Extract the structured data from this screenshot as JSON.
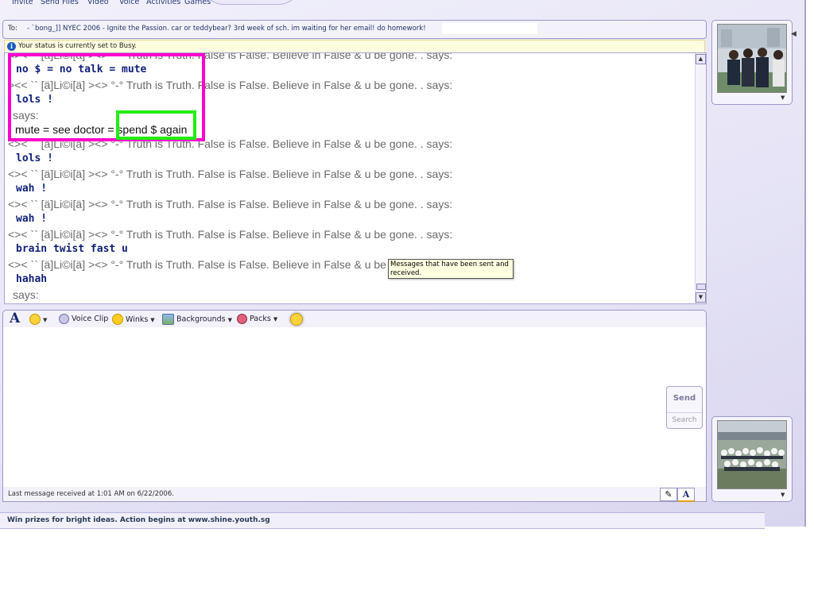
{
  "menu": {
    "items": [
      "Invite",
      "Send Files",
      "Video",
      "Voice",
      "Activities",
      "Games"
    ]
  },
  "to_bar": {
    "label": "To:",
    "recipient": "- `bong_]] NYEC 2006 - Ignite the Passion. car or teddybear?   3rd week of sch. im waiting for her email!   do homework!"
  },
  "status_notice": "Your status is currently set to Busy.",
  "conversation": [
    {
      "kind": "says",
      "text": "<>< `` [ä]Li©i[ä]  ><> °-° Truth is Truth. False is False. Believe in False & u be gone. . says:"
    },
    {
      "kind": "msg",
      "text": "no $ = no talk = mute"
    },
    {
      "kind": "says",
      "text": "><< `` [ä]Li©i[ä]  ><> °-° Truth is Truth. False is False. Believe in False & u be gone. . says:"
    },
    {
      "kind": "msg",
      "text": "lols !"
    },
    {
      "kind": "says",
      "text": "says:"
    },
    {
      "kind": "plain",
      "text": "mute  = see doctor = spend $ again"
    },
    {
      "kind": "says",
      "text": "<>< `` [ä]Li©i[ä]  ><> °-° Truth is Truth. False is False. Believe in False & u be gone. . says:"
    },
    {
      "kind": "msg",
      "text": "lols !"
    },
    {
      "kind": "says",
      "text": "<>< `` [ä]Li©i[ä]  ><> °-° Truth is Truth. False is False. Believe in False & u be gone. . says:"
    },
    {
      "kind": "msg",
      "text": "wah !"
    },
    {
      "kind": "says",
      "text": "<>< `` [ä]Li©i[ä]  ><> °-° Truth is Truth. False is False. Believe in False & u be gone. . says:"
    },
    {
      "kind": "msg",
      "text": "wah !"
    },
    {
      "kind": "says",
      "text": "<>< `` [ä]Li©i[ä]  ><> °-° Truth is Truth. False is False. Believe in False & u be gone. . says:"
    },
    {
      "kind": "msg",
      "text": "brain twist fast u"
    },
    {
      "kind": "says",
      "text": "<>< `` [ä]Li©i[ä]  ><> °-° Truth is Truth. False is False. Believe in False & u be gone. . says:"
    },
    {
      "kind": "msg",
      "text": "hahah"
    },
    {
      "kind": "says",
      "text": "says:"
    }
  ],
  "tooltip": "Messages that have been sent and received.",
  "toolbar": {
    "font_label": "A",
    "voice_clip": "Voice Clip",
    "winks": "Winks",
    "backgrounds": "Backgrounds",
    "packs": "Packs"
  },
  "compose": {
    "send_label": "Send",
    "search_label": "Search"
  },
  "last_message": "Last message received at 1:01 AM on 6/22/2006.",
  "footer": "Win prizes for bright ideas. Action begins at www.shine.youth.sg",
  "colors": {
    "annotation_pink": "#ff00cc",
    "annotation_green": "#22ee11",
    "message_blue": "#0f1f7a"
  }
}
